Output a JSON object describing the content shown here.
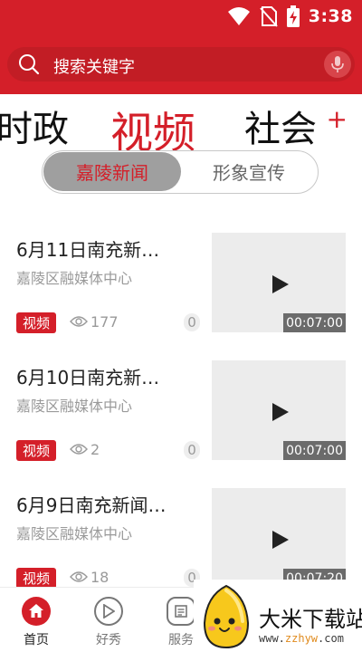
{
  "status_bar": {
    "time": "3:38",
    "icons": [
      "wifi-icon",
      "no-sim-icon",
      "battery-charging-icon"
    ]
  },
  "search": {
    "placeholder": "搜索关键字",
    "icons": [
      "search-icon",
      "mic-icon"
    ]
  },
  "channel_tabs": {
    "items": [
      {
        "label": "时政",
        "active": false
      },
      {
        "label": "视频",
        "active": true
      },
      {
        "label": "社会",
        "active": false
      }
    ],
    "add_label": "+"
  },
  "segment": {
    "options": [
      {
        "label": "嘉陵新闻",
        "active": true
      },
      {
        "label": "形象宣传",
        "active": false
      }
    ]
  },
  "news_items": [
    {
      "title": "6月11日南充新…",
      "source": "嘉陵区融媒体中心",
      "badge": "视频",
      "views": "177",
      "comments": "0",
      "duration": "00:07:00"
    },
    {
      "title": "6月10日南充新…",
      "source": "嘉陵区融媒体中心",
      "badge": "视频",
      "views": "2",
      "comments": "0",
      "duration": "00:07:00"
    },
    {
      "title": "6月9日南充新闻…",
      "source": "嘉陵区融媒体中心",
      "badge": "视频",
      "views": "18",
      "comments": "0",
      "duration": "00:07:20"
    }
  ],
  "bottom_nav": {
    "items": [
      {
        "label": "首页",
        "icon": "home-icon",
        "active": true
      },
      {
        "label": "好秀",
        "icon": "play-circle-icon",
        "active": false
      },
      {
        "label": "服务",
        "icon": "service-icon",
        "active": false
      }
    ]
  },
  "watermark": {
    "title": "大米下载站",
    "url_prefix": "www.",
    "url_highlight": "zzhyw",
    "url_suffix": ".com"
  },
  "colors": {
    "brand_red": "#d41f29",
    "segment_active_bg": "#9f9f9f",
    "text_dark": "#222222",
    "text_muted": "#9a9a9a"
  }
}
